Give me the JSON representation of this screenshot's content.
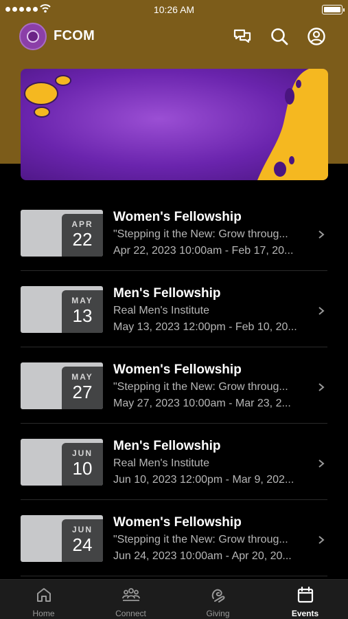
{
  "status_bar": {
    "time": "10:26 AM"
  },
  "header": {
    "title": "FCOM",
    "logo_icon": "app-logo",
    "icons": [
      "chat-icon",
      "search-icon",
      "profile-icon"
    ]
  },
  "colors": {
    "header_gold": "#7c5c1a",
    "banner_purple": "#6a24ad",
    "accent_yellow": "#f5b820",
    "date_badge": "#434445"
  },
  "events": [
    {
      "month": "APR",
      "day": "22",
      "title": "Women's Fellowship",
      "subtitle": "\"Stepping it the New: Grow throug...",
      "when": "Apr 22, 2023 10:00am - Feb 17, 20..."
    },
    {
      "month": "MAY",
      "day": "13",
      "title": "Men's Fellowship",
      "subtitle": "Real Men's Institute",
      "when": "May 13, 2023 12:00pm - Feb 10, 20..."
    },
    {
      "month": "MAY",
      "day": "27",
      "title": "Women's Fellowship",
      "subtitle": "\"Stepping it the New: Grow throug...",
      "when": "May 27, 2023 10:00am - Mar 23, 2..."
    },
    {
      "month": "JUN",
      "day": "10",
      "title": "Men's Fellowship",
      "subtitle": "Real Men's Institute",
      "when": "Jun 10, 2023 12:00pm - Mar 9, 202..."
    },
    {
      "month": "JUN",
      "day": "24",
      "title": "Women's Fellowship",
      "subtitle": "\"Stepping it the New: Grow throug...",
      "when": "Jun 24, 2023 10:00am - Apr 20, 20..."
    }
  ],
  "tabs": [
    {
      "label": "Home",
      "icon": "home-icon",
      "active": false
    },
    {
      "label": "Connect",
      "icon": "people-icon",
      "active": false
    },
    {
      "label": "Giving",
      "icon": "giving-icon",
      "active": false
    },
    {
      "label": "Events",
      "icon": "calendar-icon",
      "active": true
    }
  ]
}
